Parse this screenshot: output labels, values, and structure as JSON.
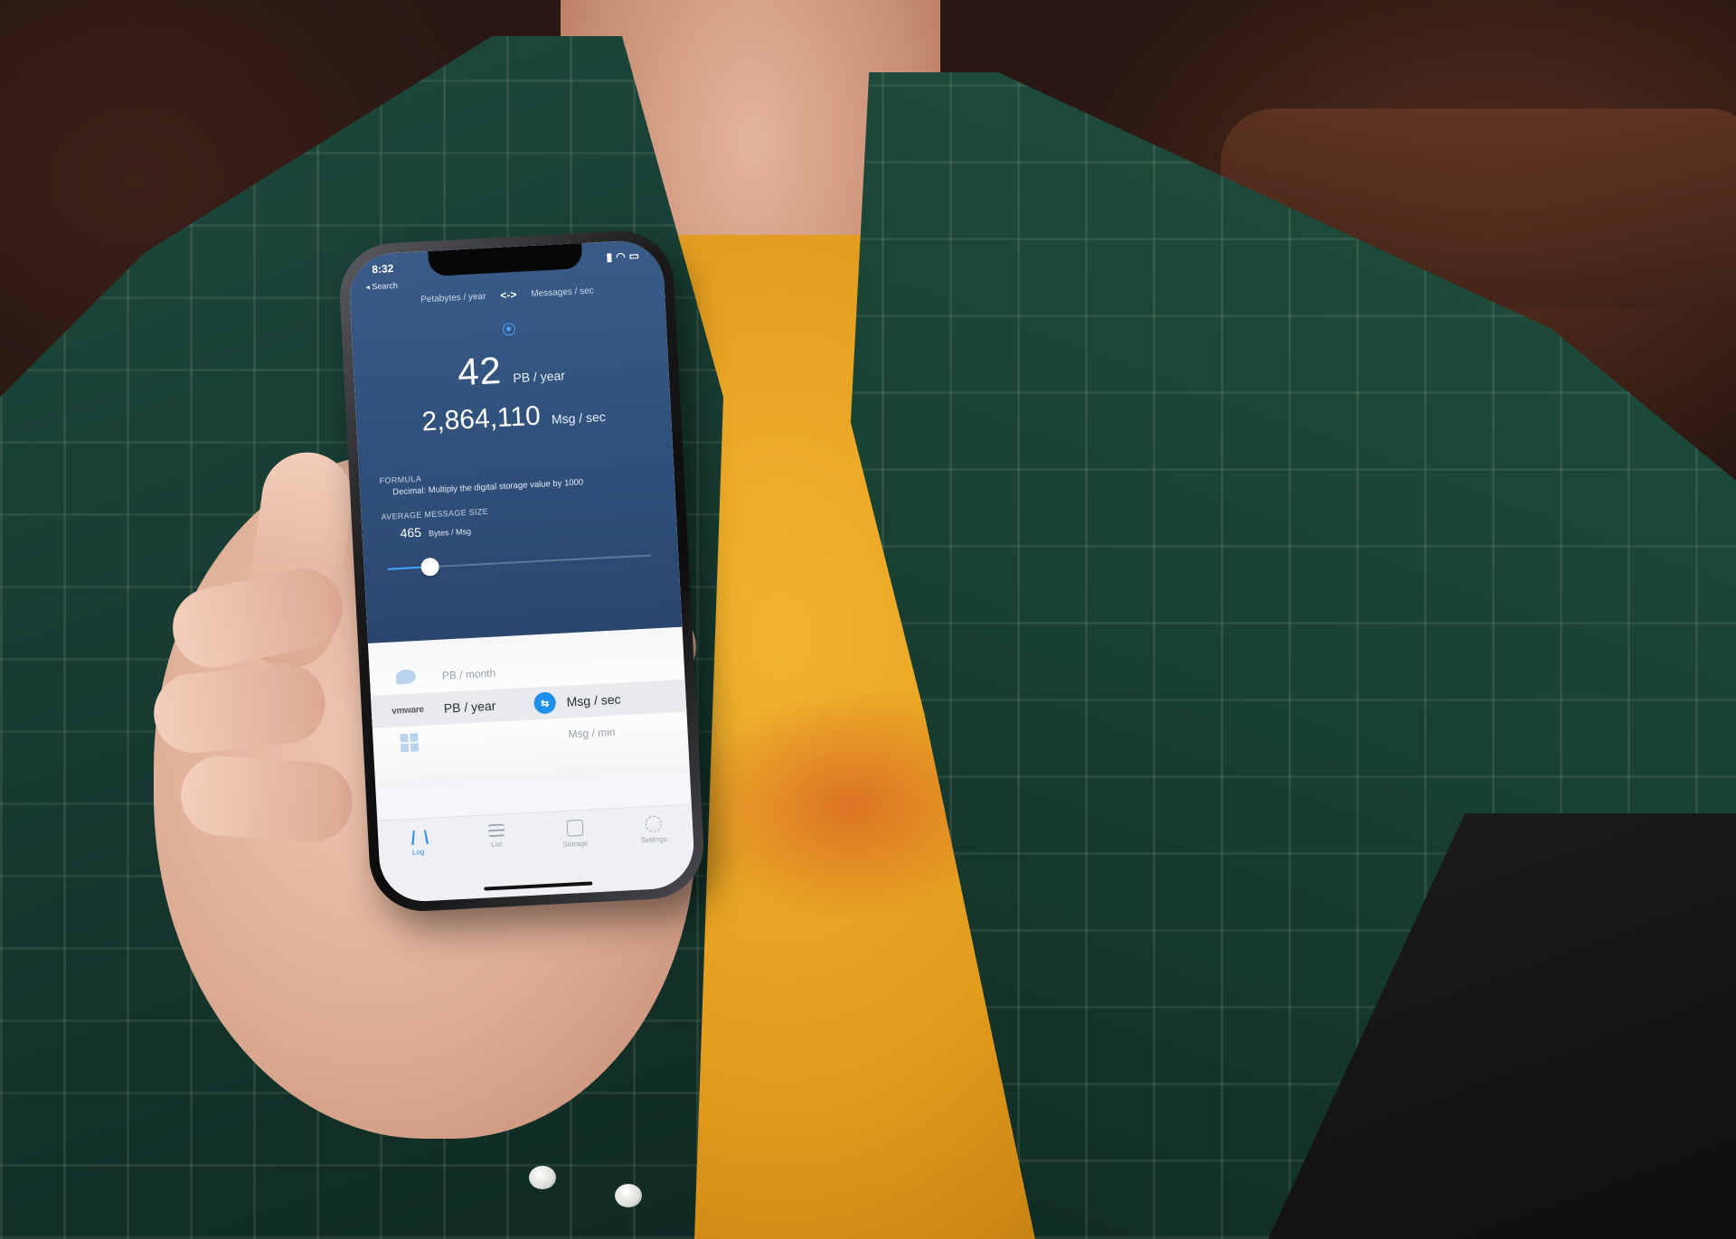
{
  "status_bar": {
    "time": "8:32",
    "back_label": "◂ Search"
  },
  "header": {
    "from_unit": "Petabytes / year",
    "swap_symbol": "<->",
    "to_unit": "Messages / sec"
  },
  "conversion": {
    "input_value": "42",
    "input_unit": "PB / year",
    "output_value": "2,864,110",
    "output_unit": "Msg / sec"
  },
  "formula": {
    "title": "FORMULA",
    "text": "Decimal: Multiply the digital storage value by 1000"
  },
  "avg_message": {
    "title": "AVERAGE MESSAGE SIZE",
    "value": "465",
    "unit": "Bytes / Msg",
    "slider_fraction": 0.16
  },
  "picker": {
    "rows": [
      {
        "logo": "",
        "left": "PB / month",
        "right": ""
      },
      {
        "logo": "vmware",
        "left": "PB / year",
        "right": "Msg / sec"
      },
      {
        "logo": "",
        "left": "",
        "right": "Msg / min"
      }
    ]
  },
  "tabs": [
    {
      "label": "Log",
      "active": true
    },
    {
      "label": "List",
      "active": false
    },
    {
      "label": "Storage",
      "active": false
    },
    {
      "label": "Settings",
      "active": false
    }
  ],
  "colors": {
    "panel_blue": "#2f4f7a",
    "accent_blue": "#1e8fe8",
    "shirt_yellow": "#f2b52f",
    "jacket_green": "#1f4a3e"
  }
}
